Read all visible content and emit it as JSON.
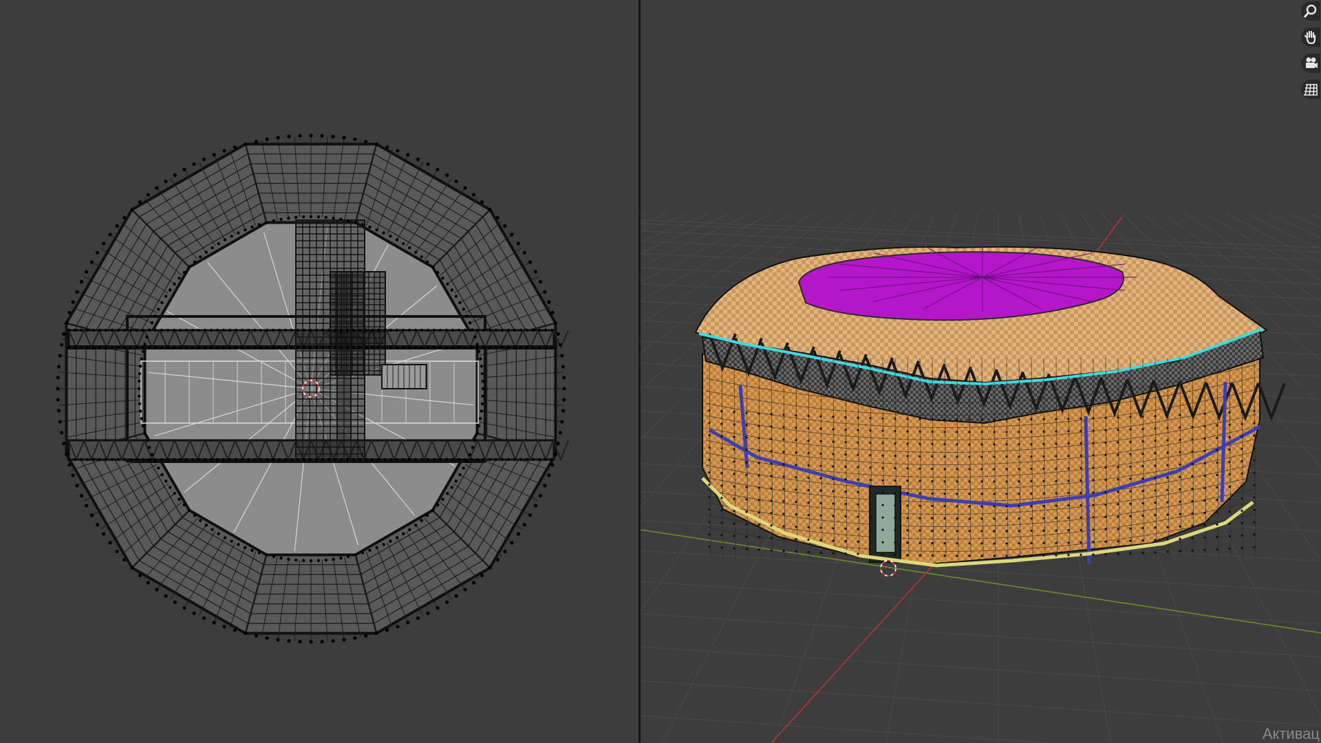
{
  "app": {
    "watermark_text": "Активац"
  },
  "viewports": [
    {
      "name": "top-view",
      "shading": "wireframe"
    },
    {
      "name": "perspective-view",
      "shading": "solid-checker"
    }
  ],
  "navigation_gizmo": [
    {
      "icon": "zoom-magnifier-icon",
      "label": "zoom"
    },
    {
      "icon": "hand-pan-icon",
      "label": "pan"
    },
    {
      "icon": "camera-icon",
      "label": "camera"
    },
    {
      "icon": "grid-ortho-icon",
      "label": "toggle-perspective"
    }
  ],
  "colors": {
    "background": "#3d3d3d",
    "mesh_wire": "#101010",
    "roof": "#b317c9",
    "wall": "#d99a4b",
    "edge_seam_cyan": "#3fd9e0",
    "edge_seam_blue": "#3c3fb0",
    "edge_seam_yellow": "#ddd87a",
    "axis_x": "#b33636",
    "axis_y": "#6b8f2a"
  }
}
